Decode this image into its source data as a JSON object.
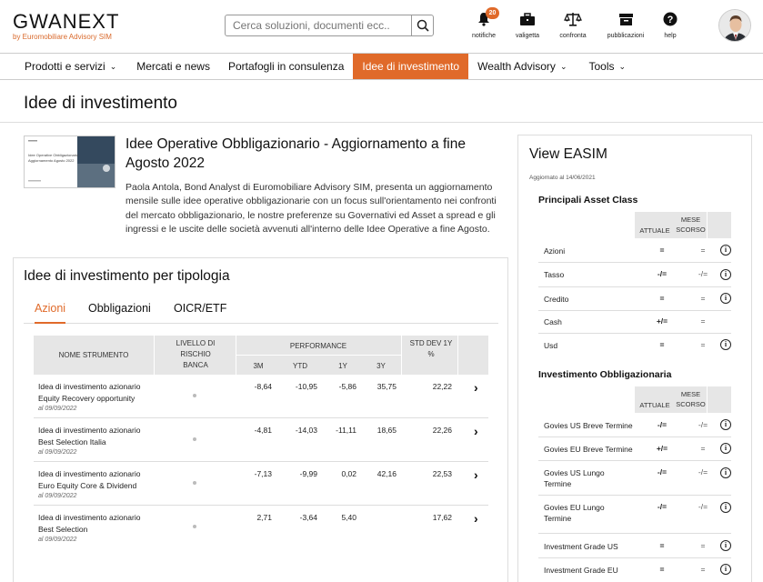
{
  "brand": {
    "logo": "GWANEXT",
    "tagline": "by Euromobiliare Advisory SIM"
  },
  "search": {
    "placeholder": "Cerca soluzioni, documenti ecc.."
  },
  "toolbar": {
    "notifiche": {
      "label": "notifiche",
      "badge": "20",
      "icon": "bell-icon"
    },
    "valigetta": {
      "label": "valigetta",
      "icon": "briefcase-icon"
    },
    "confronta": {
      "label": "confronta",
      "icon": "scale-icon"
    },
    "pubblicazioni": {
      "label": "pubblicazioni",
      "icon": "archive-icon"
    },
    "help": {
      "label": "help",
      "icon": "help-icon"
    }
  },
  "nav": [
    {
      "label": "Prodotti e servizi",
      "dropdown": true
    },
    {
      "label": "Mercati e news",
      "dropdown": false
    },
    {
      "label": "Portafogli in consulenza",
      "dropdown": false
    },
    {
      "label": "Idee di investimento",
      "dropdown": false,
      "active": true
    },
    {
      "label": "Wealth Advisory",
      "dropdown": true
    },
    {
      "label": "Tools",
      "dropdown": true
    }
  ],
  "page": {
    "title": "Idee di investimento"
  },
  "featured": {
    "thumb_title": "Idee Operative Obbligazionario Aggiornamento Agosto 2022",
    "title": "Idee Operative Obbligazionario - Aggiornamento a fine Agosto 2022",
    "description": "Paola Antola, Bond Analyst di Euromobiliare Advisory SIM, presenta un aggiornamento mensile sulle idee operative obbligazionarie con un focus sull'orientamento nei confronti del mercato obbligazionario, le nostre preferenze su Governativi ed Asset a spread e gli ingressi e le uscite delle società avvenuti all'interno delle Idee Operative a fine Agosto."
  },
  "tipologia": {
    "title": "Idee di investimento per tipologia",
    "tabs": [
      "Azioni",
      "Obbligazioni",
      "OICR/ETF"
    ],
    "active_tab": 0,
    "headers": {
      "nome": "NOME STRUMENTO",
      "livello": "LIVELLO DI RISCHIO BANCA",
      "performance": "PERFORMANCE",
      "p3m": "3M",
      "ytd": "YTD",
      "p1y": "1Y",
      "p3y": "3Y",
      "std": "STD DEV 1Y %"
    },
    "rows": [
      {
        "name1": "Idea di investimento azionario",
        "name2": "Equity Recovery opportunity",
        "date": "al 09/09/2022",
        "p3m": "-8,64",
        "ytd": "-10,95",
        "p1y": "-5,86",
        "p3y": "35,75",
        "std": "22,22"
      },
      {
        "name1": "Idea di investimento azionario",
        "name2": "Best Selection Italia",
        "date": "al 09/09/2022",
        "p3m": "-4,81",
        "ytd": "-14,03",
        "p1y": "-11,11",
        "p3y": "18,65",
        "std": "22,26"
      },
      {
        "name1": "Idea di investimento azionario",
        "name2": "Euro Equity Core & Dividend",
        "date": "al 09/09/2022",
        "p3m": "-7,13",
        "ytd": "-9,99",
        "p1y": "0,02",
        "p3y": "42,16",
        "std": "22,53"
      },
      {
        "name1": "Idea di investimento azionario",
        "name2": "Best Selection",
        "date": "al 09/09/2022",
        "p3m": "2,71",
        "ytd": "-3,64",
        "p1y": "5,40",
        "p3y": "",
        "std": "17,62"
      }
    ]
  },
  "easim": {
    "title": "View EASIM",
    "updated": "Aggiornato al 14/06/2021",
    "col_attuale": "ATTUALE",
    "col_mese": "MESE SCORSO",
    "asset_class": {
      "title": "Principali Asset Class",
      "rows": [
        {
          "label": "Azioni",
          "attuale": "=",
          "mese": "="
        },
        {
          "label": "Tasso",
          "attuale": "-/=",
          "mese": "-/="
        },
        {
          "label": "Credito",
          "attuale": "=",
          "mese": "="
        },
        {
          "label": "Cash",
          "attuale": "+/=",
          "mese": "="
        },
        {
          "label": "Usd",
          "attuale": "=",
          "mese": "="
        }
      ]
    },
    "obbligazionaria": {
      "title": "Investimento Obbligazionaria",
      "rows": [
        {
          "label": "Govies US Breve Termine",
          "attuale": "-/=",
          "mese": "-/="
        },
        {
          "label": "Govies EU Breve Termine",
          "attuale": "+/=",
          "mese": "="
        },
        {
          "label": "Govies US Lungo Termine",
          "attuale": "-/=",
          "mese": "-/="
        },
        {
          "label": "Govies EU Lungo Termine",
          "attuale": "-/=",
          "mese": "-/="
        },
        {
          "label": "Investment Grade US",
          "attuale": "=",
          "mese": "="
        },
        {
          "label": "Investment Grade EU",
          "attuale": "=",
          "mese": "="
        }
      ]
    }
  },
  "colors": {
    "accent": "#e06a2a",
    "header_gray": "#e6e6e6"
  }
}
